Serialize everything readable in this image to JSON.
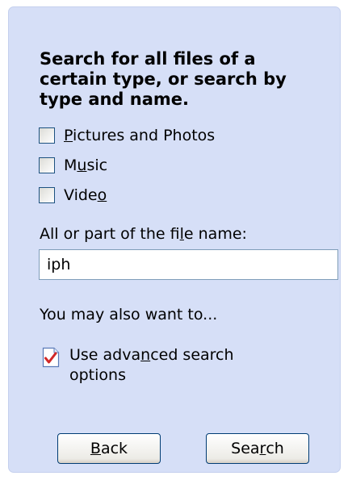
{
  "search_panel": {
    "heading": "Search for all files of a certain type, or search by type and name.",
    "file_types": [
      {
        "pre": "",
        "mnemonic": "P",
        "post": "ictures and Photos",
        "checked": false
      },
      {
        "pre": "M",
        "mnemonic": "u",
        "post": "sic",
        "checked": false
      },
      {
        "pre": "Vide",
        "mnemonic": "o",
        "post": "",
        "checked": false
      }
    ],
    "name_field": {
      "label_pre": "All or part of the fi",
      "label_mnemonic": "l",
      "label_post": "e name:",
      "value": "iph"
    },
    "also_want_label": "You may also want to...",
    "advanced_option": {
      "pre": "Use adva",
      "mnemonic": "n",
      "post": "ced search options",
      "icon": "checked-document-icon"
    },
    "buttons": {
      "back": {
        "mnemonic": "B",
        "post": "ack"
      },
      "search": {
        "pre": "Sea",
        "mnemonic": "r",
        "post": "ch"
      }
    }
  }
}
